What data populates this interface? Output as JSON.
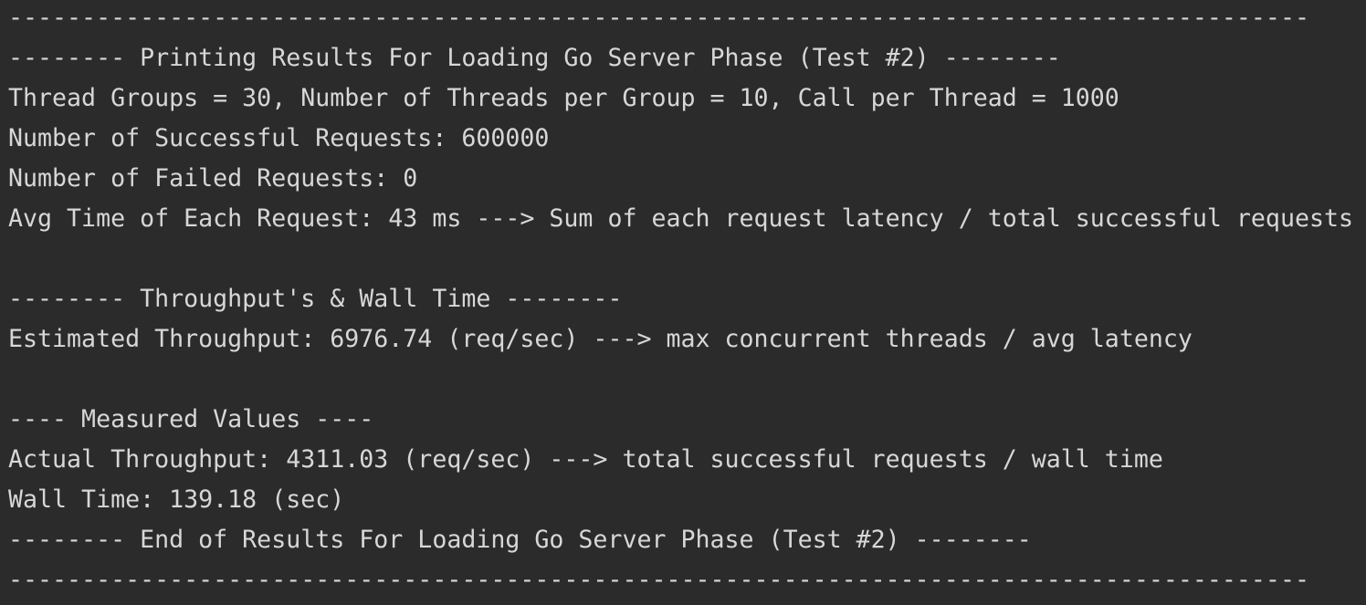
{
  "console": {
    "lines": [
      "-----------------------------------------------------------------------------------------",
      "-------- Printing Results For Loading Go Server Phase (Test #2) --------",
      "Thread Groups = 30, Number of Threads per Group = 10, Call per Thread = 1000",
      "Number of Successful Requests: 600000",
      "Number of Failed Requests: 0",
      "Avg Time of Each Request: 43 ms ---> Sum of each request latency / total successful requests",
      "",
      "-------- Throughput's & Wall Time --------",
      "Estimated Throughput: 6976.74 (req/sec) ---> max concurrent threads / avg latency",
      "",
      "---- Measured Values ----",
      "Actual Throughput: 4311.03 (req/sec) ---> total successful requests / wall time",
      "Wall Time: 139.18 (sec)",
      "-------- End of Results For Loading Go Server Phase (Test #2) --------",
      "-----------------------------------------------------------------------------------------"
    ]
  }
}
